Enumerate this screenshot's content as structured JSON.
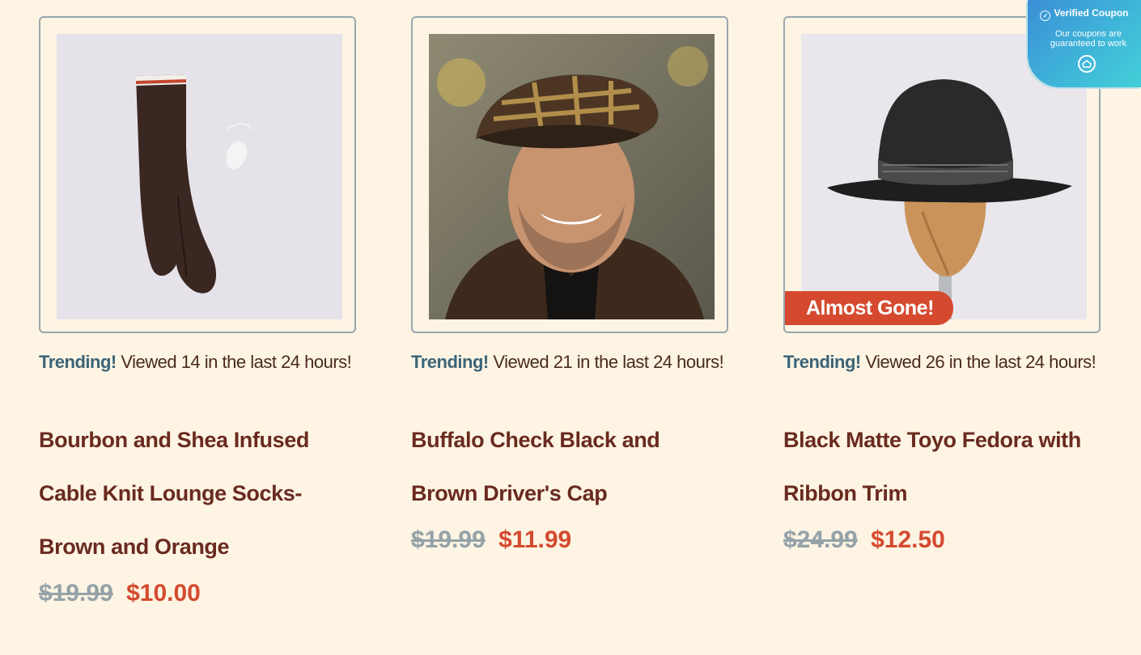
{
  "products": [
    {
      "image_desc": "brown cable knit socks with orange stripe and small tag",
      "trending_label": "Trending!",
      "trending_text": " Viewed 14 in the last 24 hours!",
      "title": "Bourbon and Shea Infused Cable Knit Lounge Socks-Brown and Orange",
      "old_price": "$19.99",
      "new_price": "$10.00"
    },
    {
      "image_desc": "smiling man wearing plaid driver's cap",
      "trending_label": "Trending!",
      "trending_text": " Viewed 21 in the last 24 hours!",
      "title": "Buffalo Check Black and Brown Driver's Cap",
      "old_price": "$19.99",
      "new_price": "$11.99"
    },
    {
      "image_desc": "black fedora on wooden mannequin head",
      "badge": "Almost Gone!",
      "trending_label": "Trending!",
      "trending_text": " Viewed 26 in the last 24 hours!",
      "title": "Black Matte Toyo Fedora with Ribbon Trim",
      "old_price": "$24.99",
      "new_price": "$12.50"
    }
  ],
  "coupon": {
    "title": "Verified Coupon",
    "subtitle_line1": "Our coupons are",
    "subtitle_line2": "guaranteed to work",
    "icon": "coupon-home-icon"
  },
  "colors": {
    "background": "#fdf4e3",
    "title": "#6a2a1f",
    "trending_label": "#3c6478",
    "new_price": "#d54a2f",
    "old_price": "#95a2a8",
    "badge": "#d54a2f"
  }
}
